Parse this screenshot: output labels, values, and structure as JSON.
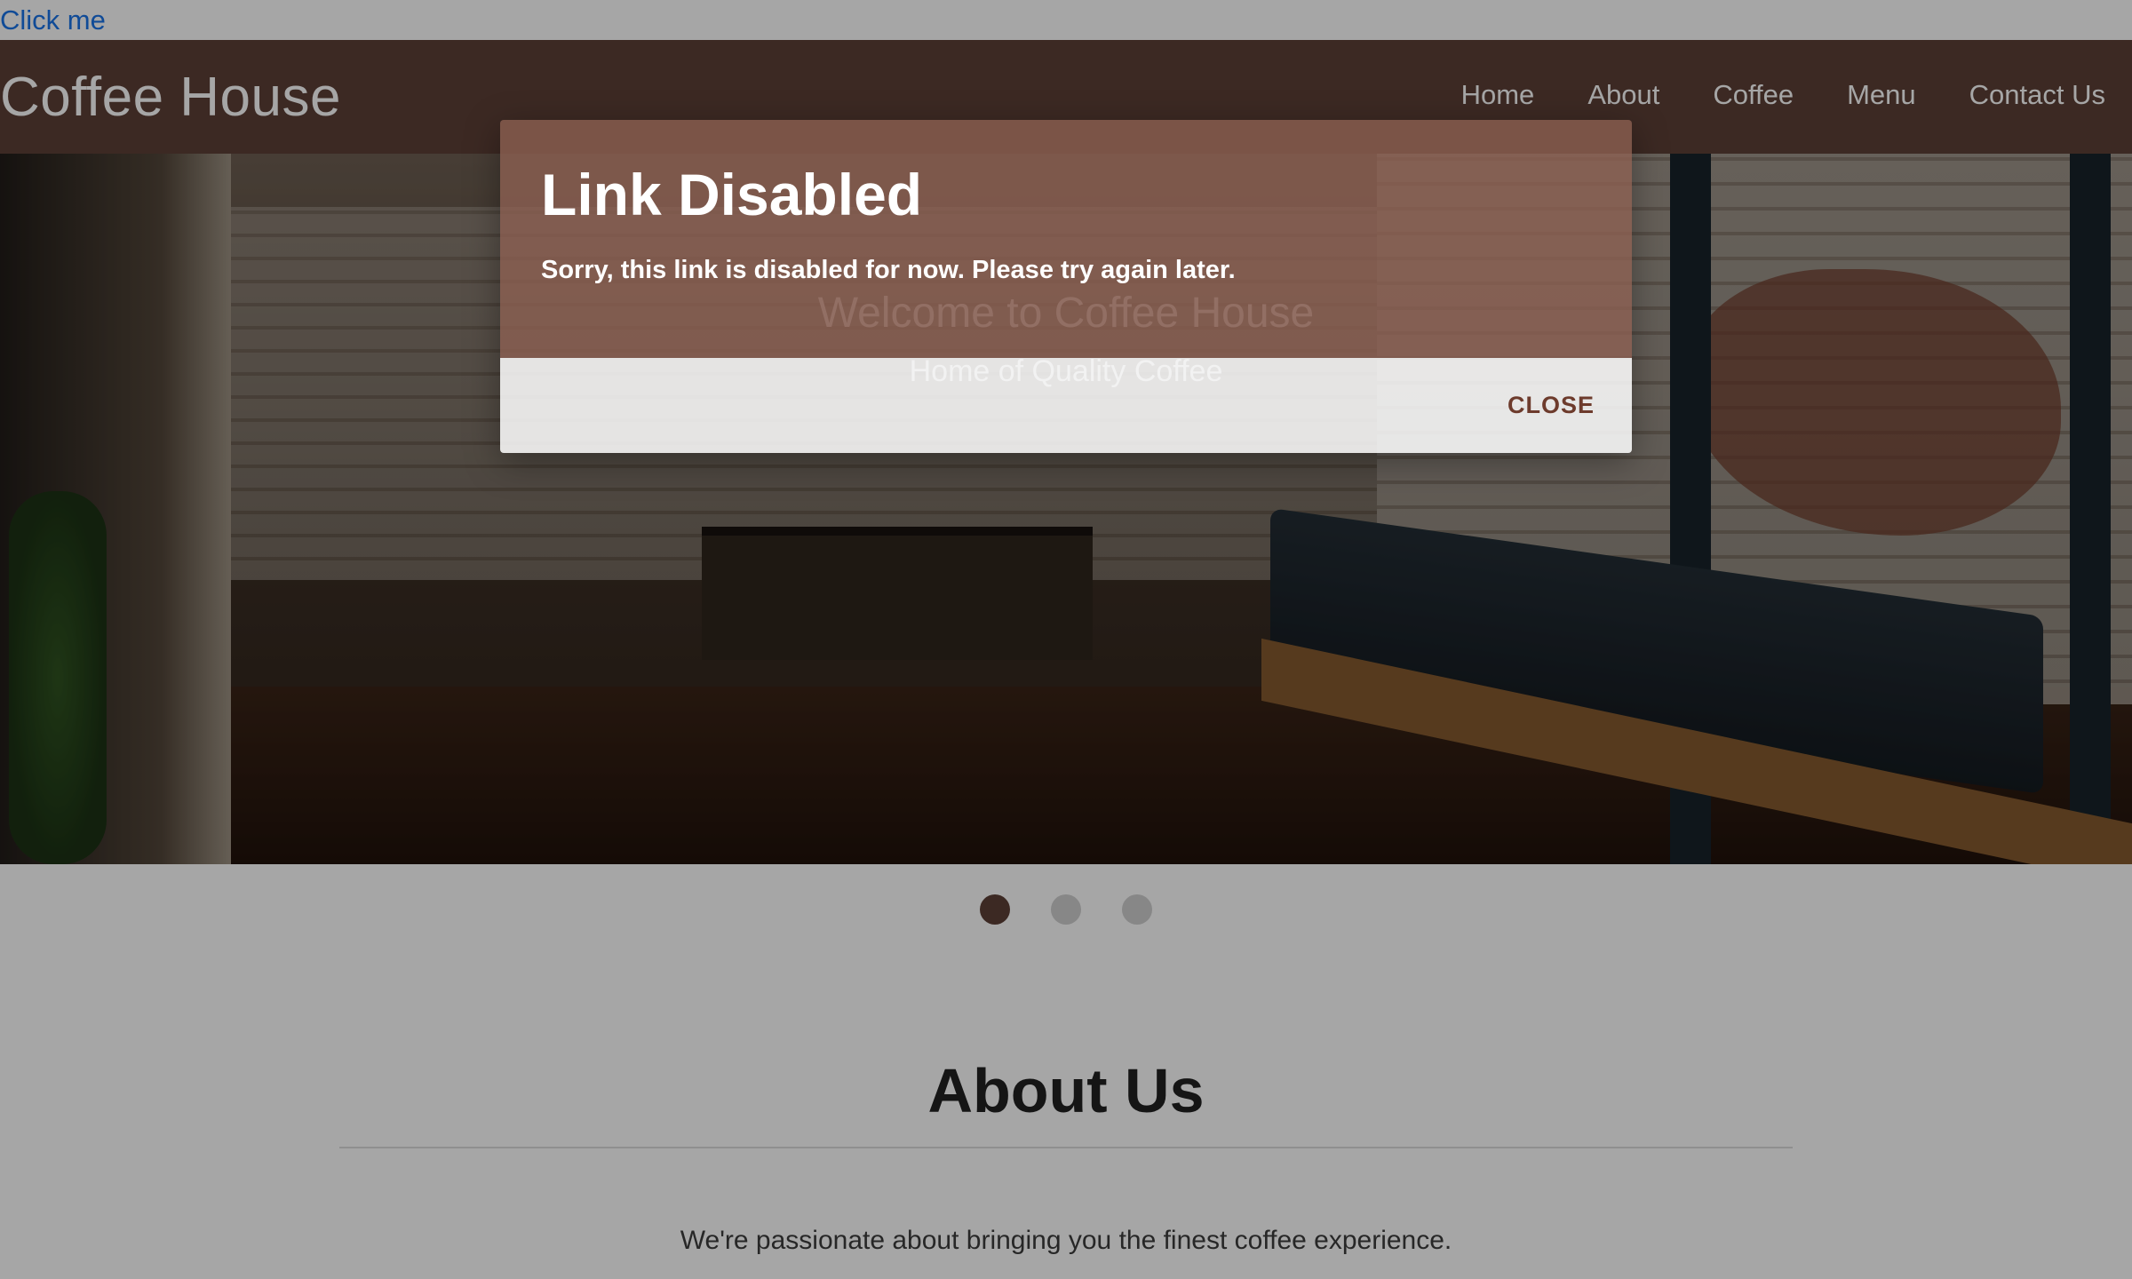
{
  "top_link": {
    "label": "Click me"
  },
  "navbar": {
    "brand": "Coffee House",
    "links": [
      "Home",
      "About",
      "Coffee",
      "Menu",
      "Contact Us"
    ]
  },
  "hero": {
    "title": "Welcome to Coffee House",
    "subtitle": "Home of Quality Coffee"
  },
  "carousel": {
    "slide_count": 3,
    "active_index": 0
  },
  "about": {
    "title": "About Us",
    "text": "We're passionate about bringing you the finest coffee experience."
  },
  "modal": {
    "title": "Link Disabled",
    "message": "Sorry, this link is disabled for now. Please try again later.",
    "close_label": "CLOSE"
  },
  "colors": {
    "brand_brown": "#5d4037",
    "modal_header": "#8d6052",
    "close_text": "#6d3b2c",
    "link_blue": "#1a73e8"
  }
}
